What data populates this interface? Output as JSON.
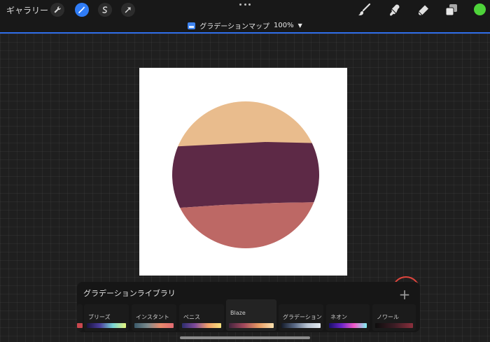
{
  "toolbar": {
    "gallery_label": "ギャラリー",
    "left_tools": [
      "wrench-icon",
      "magic-wand-icon",
      "selection-icon",
      "transform-arrow-icon"
    ],
    "right_tools": [
      "brush-icon",
      "smudge-icon",
      "eraser-icon",
      "layers-icon"
    ],
    "current_color": "#4ed33a"
  },
  "header": {
    "title": "グラデーションマップ",
    "percent": "100%"
  },
  "canvas": {
    "background": "#ffffff",
    "bands": {
      "top": "#e9bc8d",
      "middle": "#5d2946",
      "bottom": "#bd6865"
    }
  },
  "panel": {
    "title": "グラデーションライブラリ",
    "add_label": "+",
    "swatches": [
      {
        "name": "",
        "colors": [
          "#c9474e",
          "#c9474e"
        ]
      },
      {
        "name": "ブリーズ",
        "colors": [
          "#1a1340",
          "#4a3d9c",
          "#78d5d6",
          "#e6f57c"
        ]
      },
      {
        "name": "インスタント",
        "colors": [
          "#3a5a6a",
          "#7c8a8c",
          "#e88a6c",
          "#e26a72"
        ]
      },
      {
        "name": "ベニス",
        "colors": [
          "#2b2d6d",
          "#7f4a9a",
          "#f2a06a",
          "#f8e27c"
        ]
      },
      {
        "name": "Blaze",
        "colors": [
          "#44243e",
          "#a2485c",
          "#e79a63",
          "#fde3b0"
        ]
      },
      {
        "name": "グラデーション",
        "colors": [
          "#141b2a",
          "#586884",
          "#b8c4d2",
          "#e4eaf0"
        ]
      },
      {
        "name": "ネオン",
        "colors": [
          "#180f6a",
          "#6b25c9",
          "#f35ac7",
          "#7ff2f2"
        ]
      },
      {
        "name": "ノワール",
        "colors": [
          "#0d0d0d",
          "#3b1c24",
          "#8b2f3c"
        ]
      }
    ]
  }
}
